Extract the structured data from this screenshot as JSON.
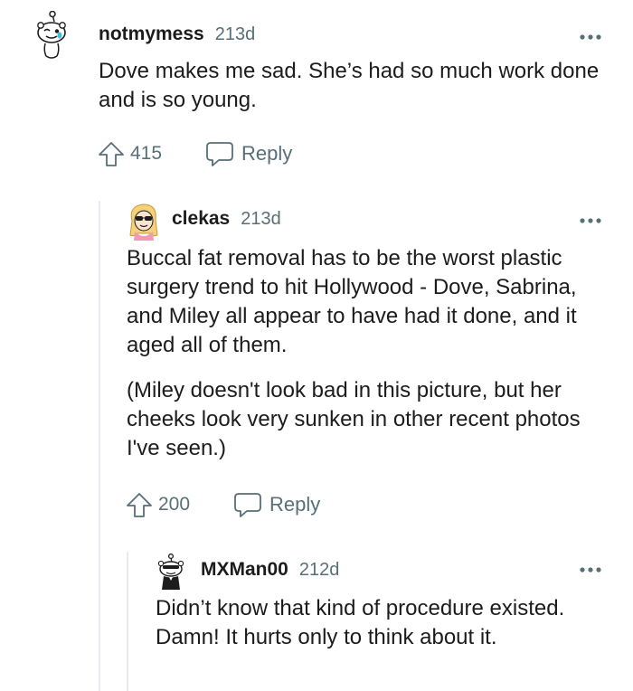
{
  "colors": {
    "text": "#1c1c1c",
    "muted": "#576f76",
    "thread_line": "#e5ebee",
    "background": "#ffffff"
  },
  "comments": [
    {
      "username": "notmymess",
      "age": "213d",
      "avatar_icon": "snoo-avatar-icon",
      "paragraphs": [
        "Dove makes me sad. She’s had so much work done and is so young."
      ],
      "votes": "415",
      "reply_label": "Reply"
    },
    {
      "username": "clekas",
      "age": "213d",
      "avatar_icon": "blonde-sunglasses-avatar-icon",
      "paragraphs": [
        "Buccal fat removal has to be the worst plastic surgery trend to hit Hollywood - Dove, Sabrina, and Miley all appear to have had it done, and it aged all of them.",
        "(Miley doesn't look bad in this picture, but her cheeks look very sunken in other recent photos I've seen.)"
      ],
      "votes": "200",
      "reply_label": "Reply"
    },
    {
      "username": "MXMan00",
      "age": "212d",
      "avatar_icon": "snoo-suit-avatar-icon",
      "paragraphs": [
        "Didn’t know that kind of procedure existed. Damn! It hurts only to think about it."
      ]
    }
  ]
}
